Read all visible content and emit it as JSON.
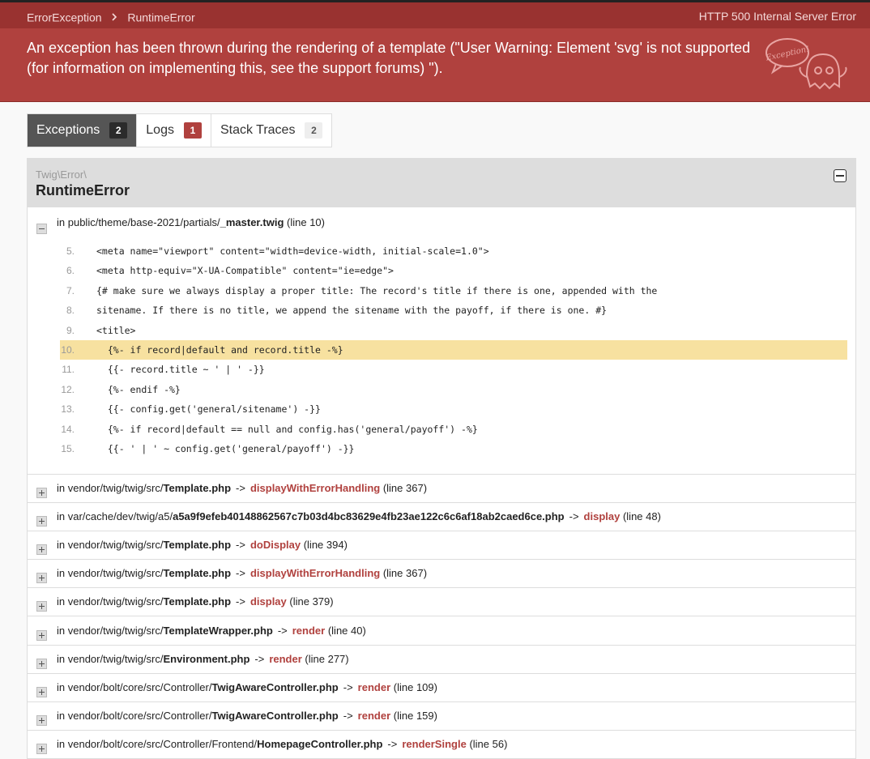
{
  "header": {
    "breadcrumb": [
      "ErrorException",
      "RuntimeError"
    ],
    "http_status": "HTTP 500 Internal Server Error",
    "message": "An exception has been thrown during the rendering of a template (\"User Warning: Element 'svg' is not supported (for information on implementing this, see the support forums) \").",
    "ghost_text": "Exception!"
  },
  "tabs": [
    {
      "label": "Exceptions",
      "count": "2"
    },
    {
      "label": "Logs",
      "count": "1"
    },
    {
      "label": "Stack Traces",
      "count": "2"
    }
  ],
  "exception": {
    "namespace": "Twig\\Error\\",
    "class": "RuntimeError",
    "first_trace": {
      "prefix": "in ",
      "path": "public/theme/base-2021/partials/",
      "file": "_master.twig",
      "line": "(line 10)"
    },
    "code": [
      {
        "n": "5.",
        "text": "<meta name=\"viewport\" content=\"width=device-width, initial-scale=1.0\">"
      },
      {
        "n": "6.",
        "text": "<meta http-equiv=\"X-UA-Compatible\" content=\"ie=edge\">"
      },
      {
        "n": "7.",
        "text": "{# make sure we always display a proper title: The record's title if there is one, appended with the"
      },
      {
        "n": "8.",
        "text": "sitename. If there is no title, we append the sitename with the payoff, if there is one. #}"
      },
      {
        "n": "9.",
        "text": "<title>"
      },
      {
        "n": "10.",
        "text": "  {%- if record|default and record.title -%}"
      },
      {
        "n": "11.",
        "text": "  {{- record.title ~ ' | ' -}}"
      },
      {
        "n": "12.",
        "text": "  {%- endif -%}"
      },
      {
        "n": "13.",
        "text": "  {{- config.get('general/sitename') -}}"
      },
      {
        "n": "14.",
        "text": "  {%- if record|default == null and config.has('general/payoff') -%}"
      },
      {
        "n": "15.",
        "text": "  {{- ' | ' ~ config.get('general/payoff') -}}"
      }
    ],
    "highlight_line": "10.",
    "traces": [
      {
        "path": "vendor/twig/twig/src/",
        "file": "Template.php",
        "fn": "displayWithErrorHandling",
        "line": "(line 367)"
      },
      {
        "path": "var/cache/dev/twig/a5/",
        "file": "a5a9f9efeb40148862567c7b03d4bc83629e4fb23ae122c6c6af18ab2caed6ce.php",
        "fn": "display",
        "line": "(line 48)"
      },
      {
        "path": "vendor/twig/twig/src/",
        "file": "Template.php",
        "fn": "doDisplay",
        "line": "(line 394)"
      },
      {
        "path": "vendor/twig/twig/src/",
        "file": "Template.php",
        "fn": "displayWithErrorHandling",
        "line": "(line 367)"
      },
      {
        "path": "vendor/twig/twig/src/",
        "file": "Template.php",
        "fn": "display",
        "line": "(line 379)"
      },
      {
        "path": "vendor/twig/twig/src/",
        "file": "TemplateWrapper.php",
        "fn": "render",
        "line": "(line 40)"
      },
      {
        "path": "vendor/twig/twig/src/",
        "file": "Environment.php",
        "fn": "render",
        "line": "(line 277)"
      },
      {
        "path": "vendor/bolt/core/src/Controller/",
        "file": "TwigAwareController.php",
        "fn": "render",
        "line": "(line 109)"
      },
      {
        "path": "vendor/bolt/core/src/Controller/",
        "file": "TwigAwareController.php",
        "fn": "render",
        "line": "(line 159)"
      },
      {
        "path": "vendor/bolt/core/src/Controller/Frontend/",
        "file": "HomepageController.php",
        "fn": "renderSingle",
        "line": "(line 56)"
      }
    ]
  }
}
